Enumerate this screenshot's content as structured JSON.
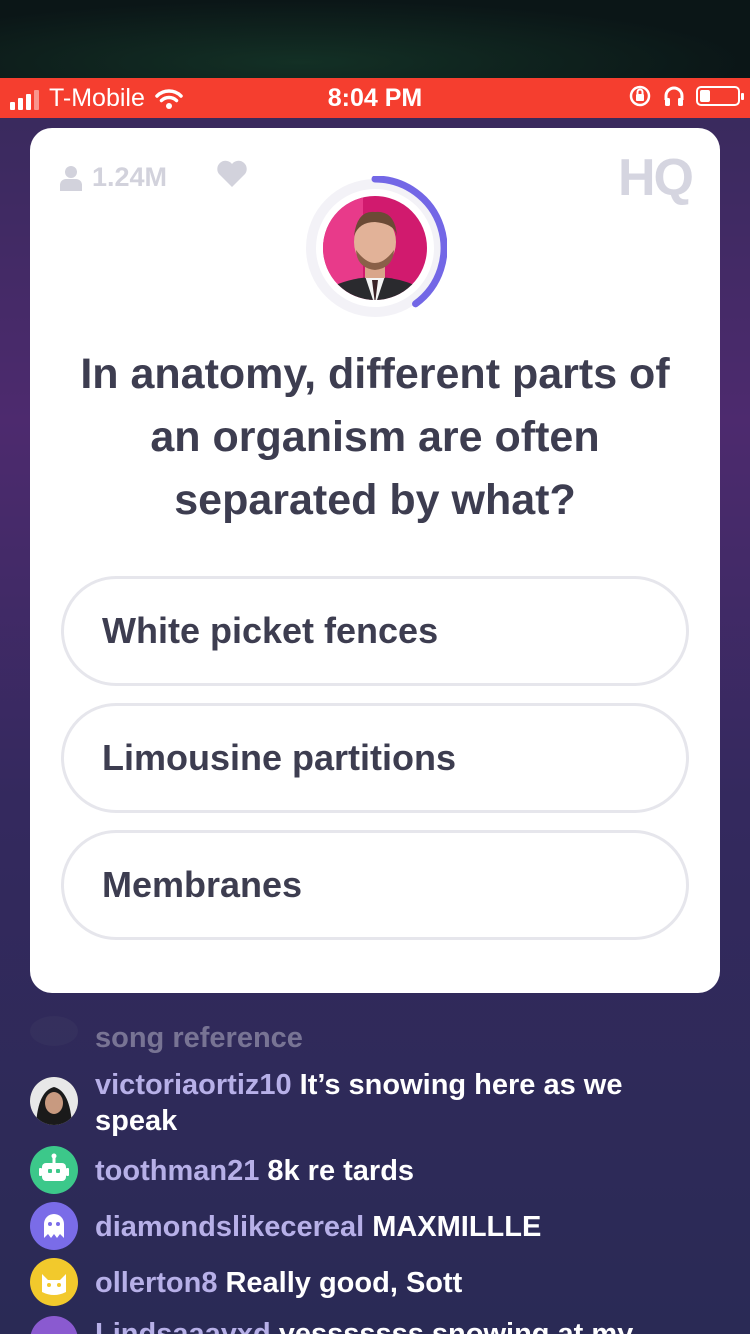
{
  "status_bar": {
    "carrier": "T-Mobile",
    "time": "8:04 PM"
  },
  "card": {
    "viewer_count": "1.24M",
    "logo": "HQ",
    "question": "In anatomy, different parts of an organism are often separated by what?",
    "answers": [
      {
        "label": "White picket fences"
      },
      {
        "label": "Limousine partitions"
      },
      {
        "label": "Membranes"
      }
    ],
    "timer_progress": 0.4
  },
  "chat": {
    "messages": [
      {
        "user": "",
        "text": "song reference",
        "avatar_color": "#3a3560"
      },
      {
        "user": "victoriaortiz10",
        "text": "It’s snowing here as we speak",
        "avatar_color": "#222222"
      },
      {
        "user": "toothman21",
        "text": "8k re tards",
        "avatar_color": "#3cc88a",
        "avatar_icon": "robot-icon"
      },
      {
        "user": "diamondslikecereal",
        "text": "MAXMILLLE",
        "avatar_color": "#7a6ce8",
        "avatar_icon": "ghost-icon"
      },
      {
        "user": "ollerton8",
        "text": "Really good, Sott",
        "avatar_color": "#f2c92c",
        "avatar_icon": "cat-icon"
      },
      {
        "user": "Lindsaaayxd",
        "text": "yesssssss snowing at my",
        "avatar_color": "#8a5ad0"
      }
    ]
  },
  "colors": {
    "status_bar": "#f53e2f",
    "timer_arc": "#7367e6",
    "username": "#b7b0e8",
    "question_text": "#3d3d50"
  }
}
